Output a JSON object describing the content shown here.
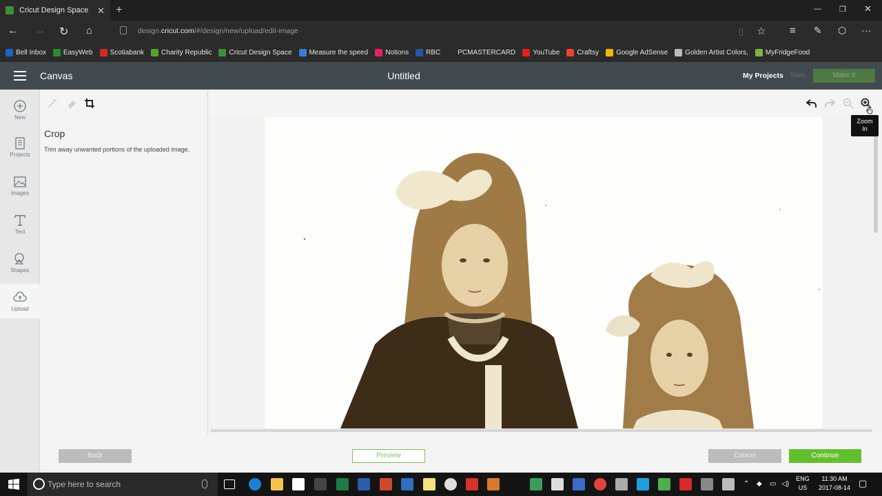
{
  "browser": {
    "tab_title": "Cricut Design Space",
    "url_prefix": "design.",
    "url_domain": "cricut.com",
    "url_path": "/#/design/new/upload/edit-image",
    "favorites": [
      {
        "label": "Bell Inbox",
        "color": "#1f62c9"
      },
      {
        "label": "EasyWeb",
        "color": "#2d8a30"
      },
      {
        "label": "Scotiabank",
        "color": "#d52b1e"
      },
      {
        "label": "Charity Republic",
        "color": "#5aa02c"
      },
      {
        "label": "Cricut Design Space",
        "color": "#3f8f3a"
      },
      {
        "label": "Measure the speed",
        "color": "#3a7bd5"
      },
      {
        "label": "Notions",
        "color": "#e91e63"
      },
      {
        "label": "RBC",
        "color": "#2557a7"
      },
      {
        "label": "PCMASTERCARD",
        "color": "#2b2b2b"
      },
      {
        "label": "YouTube",
        "color": "#e62117"
      },
      {
        "label": "Craftsy",
        "color": "#e8462e"
      },
      {
        "label": "Google AdSense",
        "color": "#f5b700"
      },
      {
        "label": "Golden Artist Colors,",
        "color": "#bbbbbb"
      },
      {
        "label": "MyFridgeFood",
        "color": "#7cb342"
      }
    ]
  },
  "app": {
    "section": "Canvas",
    "title": "Untitled",
    "my_projects": "My Projects",
    "save": "Save",
    "make_it": "Make It",
    "rail": [
      {
        "label": "New",
        "icon": "plus-circle-icon"
      },
      {
        "label": "Projects",
        "icon": "projects-icon"
      },
      {
        "label": "Images",
        "icon": "image-icon"
      },
      {
        "label": "Text",
        "icon": "text-icon"
      },
      {
        "label": "Shapes",
        "icon": "shapes-icon"
      },
      {
        "label": "Upload",
        "icon": "upload-cloud-icon"
      }
    ],
    "panel": {
      "title": "Crop",
      "description": "Trim away unwanted portions of the uploaded image."
    },
    "tooltip": "Zoom In",
    "buttons": {
      "back": "Back",
      "preview": "Preview",
      "cancel": "Cancel",
      "continue": "Continue"
    },
    "colors": {
      "header": "#414a4f",
      "accent_green": "#63c02d"
    }
  },
  "taskbar": {
    "search_placeholder": "Type here to search",
    "lang": "ENG",
    "region": "US",
    "time": "11:30 AM",
    "date": "2017-08-14"
  }
}
